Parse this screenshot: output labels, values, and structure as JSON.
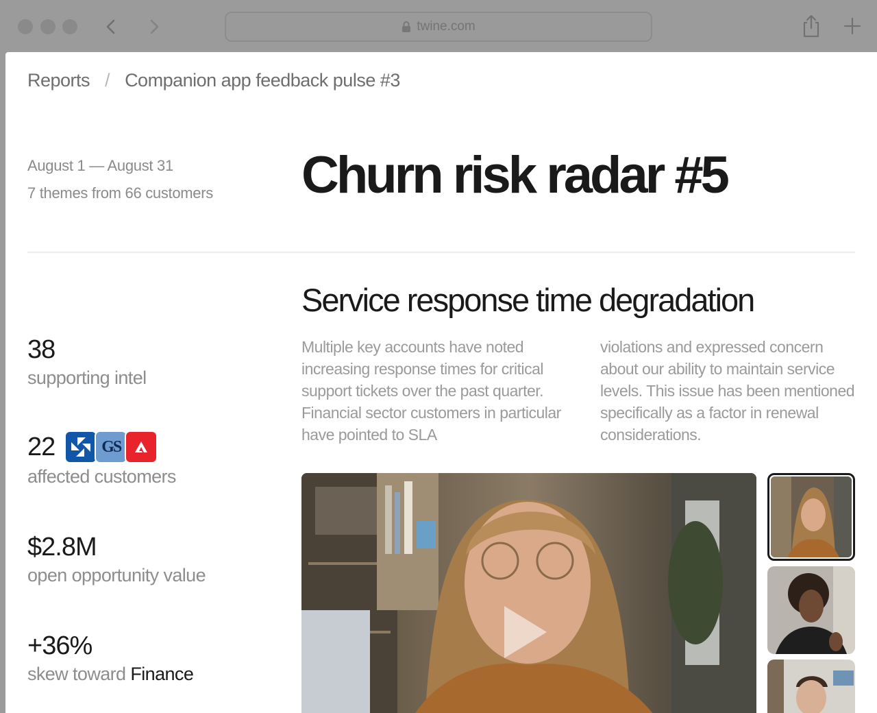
{
  "browser": {
    "url": "twine.com"
  },
  "breadcrumb": {
    "parent": "Reports",
    "separator": "/",
    "current": "Companion app feedback pulse #3"
  },
  "meta": {
    "date_range": "August 1 — August 31",
    "summary": "7 themes from 66 customers"
  },
  "title": "Churn risk radar #5",
  "stats": [
    {
      "value": "38",
      "label": "supporting intel"
    },
    {
      "value": "22",
      "label": "affected customers",
      "logos": [
        "chase-logo",
        "gs-logo",
        "adobe-logo"
      ],
      "logo_gs_text": "GS"
    },
    {
      "value": "$2.8M",
      "label": "open opportunity value"
    },
    {
      "value": "+36%",
      "label": "skew toward",
      "label_emphasis": "Finance"
    }
  ],
  "section": {
    "title": "Service response time degradation",
    "body_col1": "Multiple key accounts have noted increasing response times for critical support tickets over the past quarter. Financial sector customers in particular have pointed to SLA",
    "body_col2": "violations and expressed concern about our ability to maintain service levels. This issue has been mentioned specifically as a factor in renewal considerations."
  },
  "colors": {
    "title_text": "#1a1a1a",
    "muted_text": "#8d8d8d",
    "body_text": "#9a9a9a",
    "chrome": "#9b9b9b"
  }
}
